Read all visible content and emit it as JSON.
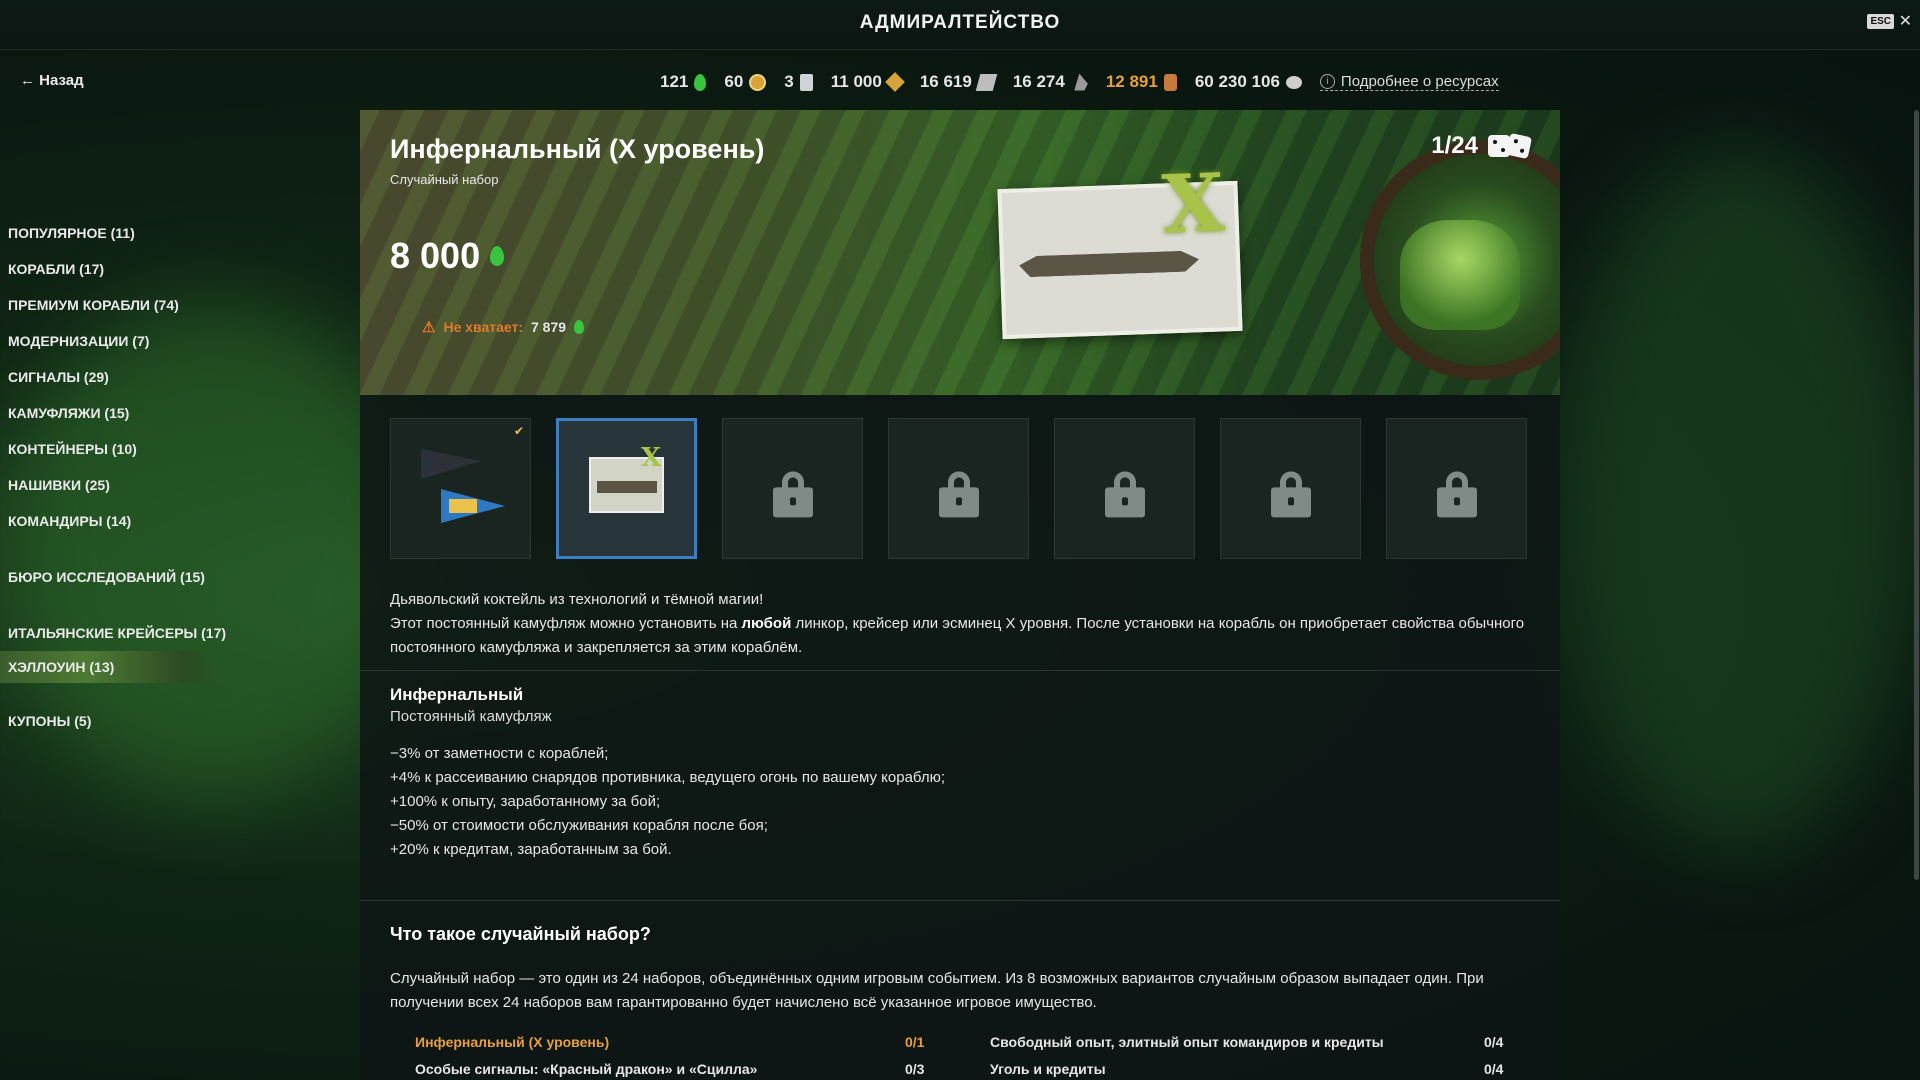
{
  "header": {
    "title": "АДМИРАЛТЕЙСТВО",
    "esc_label": "ESC",
    "close_label": "✕"
  },
  "nav": {
    "back_label": "Назад"
  },
  "resources": {
    "items": [
      {
        "value": "121",
        "icon": "doubloon-drop-icon"
      },
      {
        "value": "60",
        "icon": "coin-icon"
      },
      {
        "value": "3",
        "icon": "container-icon"
      },
      {
        "value": "11 000",
        "icon": "diamond-icon"
      },
      {
        "value": "16 619",
        "icon": "steel-icon"
      },
      {
        "value": "16 274",
        "icon": "coal-icon"
      },
      {
        "value": "12 891",
        "icon": "barrel-icon",
        "color": "#e8a03a"
      },
      {
        "value": "60 230 106",
        "icon": "credits-icon"
      }
    ],
    "more_label": "Подробнее о ресурсах"
  },
  "sidebar": {
    "items": [
      {
        "label": "ПОПУЛЯРНОЕ (11)"
      },
      {
        "label": "КОРАБЛИ (17)"
      },
      {
        "label": "ПРЕМИУМ КОРАБЛИ (74)"
      },
      {
        "label": "МОДЕРНИЗАЦИИ (7)"
      },
      {
        "label": "СИГНАЛЫ (29)"
      },
      {
        "label": "КАМУФЛЯЖИ (15)"
      },
      {
        "label": "КОНТЕЙНЕРЫ (10)"
      },
      {
        "label": "НАШИВКИ (25)"
      },
      {
        "label": "КОМАНДИРЫ (14)"
      },
      {
        "label": "БЮРО ИССЛЕДОВАНИЙ (15)"
      },
      {
        "label": "ИТАЛЬЯНСКИЕ КРЕЙСЕРЫ (17)"
      },
      {
        "label": "ХЭЛЛОУИН (13)",
        "active": true
      },
      {
        "label": "КУПОНЫ (5)"
      }
    ]
  },
  "banner": {
    "title": "Инфернальный (X уровень)",
    "subtitle": "Случайный набор",
    "price": "8 000",
    "shortage_label": "Не хватает:",
    "shortage_value": "7 879",
    "counter": "1/24",
    "tier_mark": "X"
  },
  "rewards": {
    "slots": [
      {
        "kind": "flag",
        "received": true
      },
      {
        "kind": "camo-card",
        "selected": true
      },
      {
        "kind": "locked"
      },
      {
        "kind": "locked"
      },
      {
        "kind": "locked"
      },
      {
        "kind": "locked"
      },
      {
        "kind": "locked"
      }
    ]
  },
  "description": {
    "line1": "Дьявольский коктейль из технологий и тёмной магии!",
    "line2_before": "Этот постоянный камуфляж можно установить на ",
    "line2_bold": "любой",
    "line2_after": " линкор, крейсер или эсминец X уровня. После установки на корабль он приобретает свойства обычного постоянного камуфляжа и закрепляется за этим кораблём."
  },
  "details": {
    "title": "Инфернальный",
    "type": "Постоянный камуфляж",
    "bonuses": [
      "−3% от заметности с кораблей;",
      "+4% к рассеиванию снарядов противника, ведущего огонь по вашему кораблю;",
      "+100% к опыту, заработанному за бой;",
      "−50% от стоимости обслуживания корабля после боя;",
      "+20% к кредитам, заработанным за бой."
    ]
  },
  "random_bundle": {
    "title": "Что такое случайный набор?",
    "text": "Случайный набор — это один из 24 наборов, объединённых одним игровым событием. Из 8 возможных вариантов случайным образом выпадает один. При получении всех 24 наборов вам гарантированно будет начислено всё указанное игровое имущество.",
    "progress": [
      {
        "label": "Инфернальный (X уровень)",
        "value": "0/1",
        "highlight": true
      },
      {
        "label": "Свободный опыт, элитный опыт командиров и кредиты",
        "value": "0/4"
      },
      {
        "label": "Особые сигналы: «Красный дракон» и «Сцилла»",
        "value": "0/3"
      },
      {
        "label": "Уголь и кредиты",
        "value": "0/4"
      }
    ]
  },
  "colors": {
    "accent_orange": "#e8a03a",
    "doubloon_green": "#39c440",
    "selected_border": "#3b7fc2",
    "warning": "#e07a2a"
  }
}
